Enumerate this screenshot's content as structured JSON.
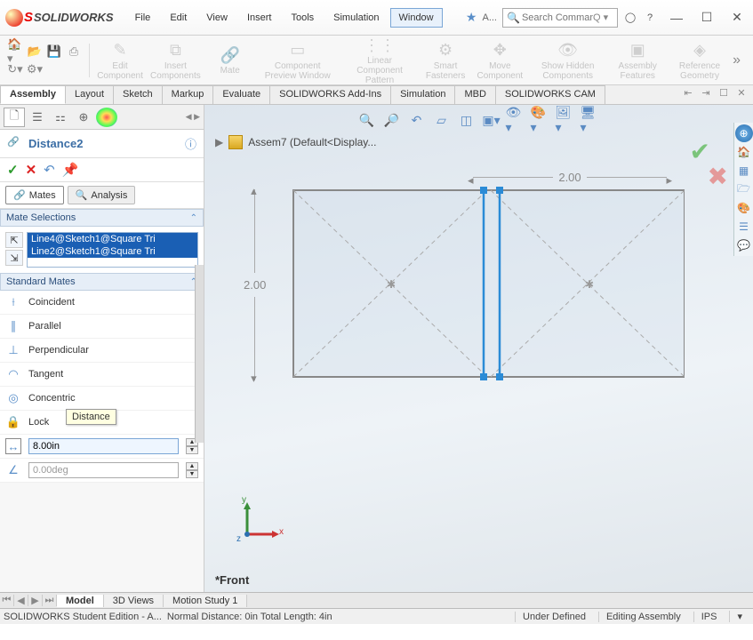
{
  "app": {
    "brand_ds": "S",
    "brand_text": "SOLIDWORKS"
  },
  "menu": {
    "file": "File",
    "edit": "Edit",
    "view": "View",
    "insert": "Insert",
    "tools": "Tools",
    "simulation": "Simulation",
    "window": "Window"
  },
  "search": {
    "placeholder": "Search Comman",
    "trail": "A..."
  },
  "ribbon": {
    "edit_component": "Edit\nComponent",
    "insert_components": "Insert\nComponents",
    "mate": "Mate",
    "component_preview": "Component\nPreview\nWindow",
    "linear_pattern": "Linear Component\nPattern",
    "smart_fasteners": "Smart\nFasteners",
    "move_component": "Move\nComponent",
    "show_hidden": "Show\nHidden\nComponents",
    "assembly_features": "Assembly\nFeatures",
    "reference_geometry": "Reference\nGeometry"
  },
  "tabs": [
    "Assembly",
    "Layout",
    "Sketch",
    "Markup",
    "Evaluate",
    "SOLIDWORKS Add-Ins",
    "Simulation",
    "MBD",
    "SOLIDWORKS CAM"
  ],
  "pm": {
    "title": "Distance2",
    "tab_mates": "Mates",
    "tab_analysis": "Analysis",
    "sect_selections": "Mate Selections",
    "sel_items": [
      "Line4@Sketch1@Square Tri",
      "Line2@Sketch1@Square Tri"
    ],
    "sect_standard": "Standard Mates",
    "mates": {
      "coincident": "Coincident",
      "parallel": "Parallel",
      "perpendicular": "Perpendicular",
      "tangent": "Tangent",
      "concentric": "Concentric",
      "lock": "Lock"
    },
    "distance_value": "8.00in",
    "angle_value": "0.00deg",
    "tooltip": "Distance"
  },
  "viewport": {
    "doc": "Assem7  (Default<Display...",
    "dim_w": "2.00",
    "dim_h": "2.00",
    "viewname": "*Front",
    "axis_y": "y",
    "axis_x": "x",
    "axis_z": "z"
  },
  "bottom_tabs": [
    "Model",
    "3D Views",
    "Motion Study 1"
  ],
  "status": {
    "left": "SOLIDWORKS Student Edition - A...",
    "mid": "Normal Distance: 0in Total Length: 4in",
    "under": "Under Defined",
    "mode": "Editing Assembly",
    "units": "IPS"
  }
}
